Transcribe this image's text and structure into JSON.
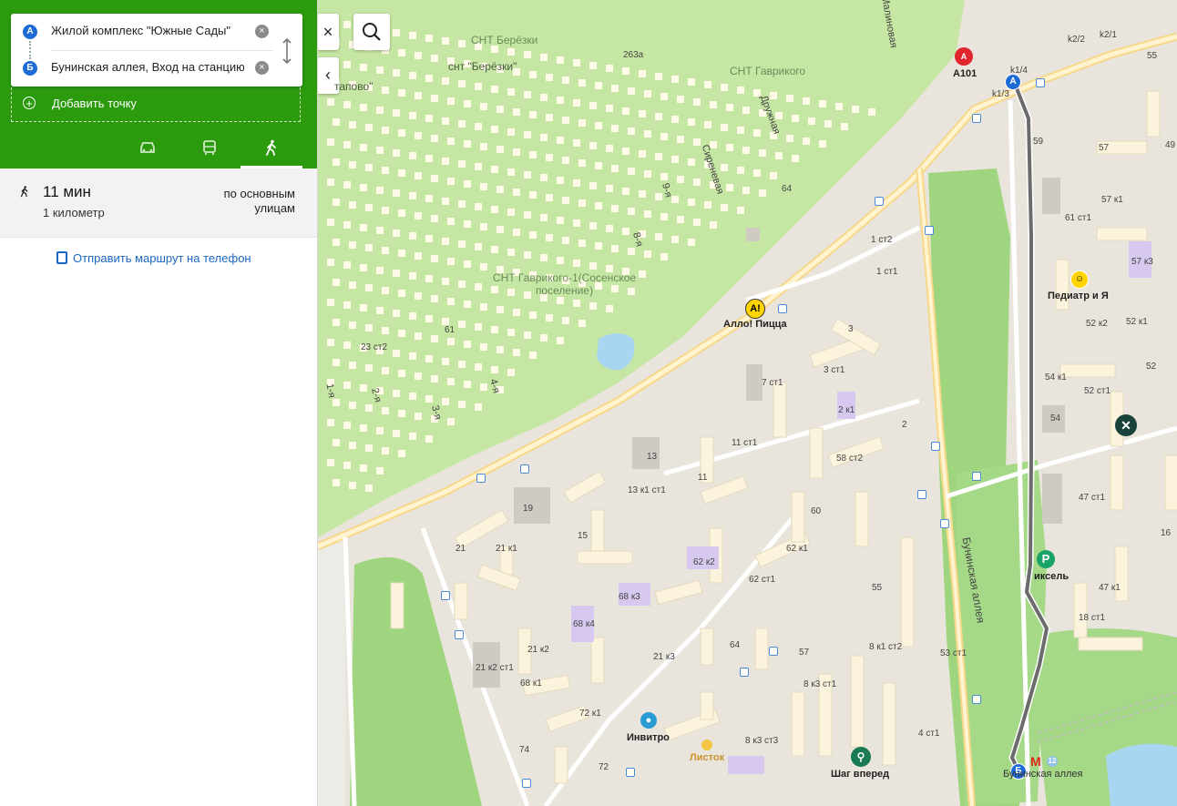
{
  "route_form": {
    "point_a": {
      "badge": "А",
      "text": "Жилой комплекс \"Южные Сады\""
    },
    "point_b": {
      "badge": "Б",
      "text": "Бунинская аллея, Вход на станцию"
    },
    "add_point": "Добавить точку",
    "active_mode": "walking",
    "modes": [
      "car",
      "transit",
      "walking"
    ]
  },
  "summary": {
    "duration": "11 мин",
    "distance": "1 километр",
    "via": "по основным улицам"
  },
  "send_to_phone": "Отправить маршрут на телефон",
  "map": {
    "controls": {
      "close": "×",
      "collapse": "‹"
    },
    "area_labels": {
      "snt_bereozki": "СНТ Берёзки",
      "snt_bereozki2": "снт \"Берёзки\"",
      "snt_gavrikovo": "СНТ Гаврикого",
      "snt_gavrikovo1": "СНТ Гаврикого-1(Сосенское поселение)",
      "stapovo": "тапово\""
    },
    "street_labels": {
      "druzhnaya": "Дружная",
      "sirenevaya": "Сиреневая",
      "malinovaya": "Малиновая",
      "buninskaya": "Бунинская аллея",
      "buninskaya_stop": "Бунинская аллея",
      "s9": "9-я",
      "s8": "8-я",
      "s4": "4-я",
      "s3": "3-я",
      "s2": "2-я",
      "s1": "1-я",
      "n263a": "263а",
      "n64": "64",
      "n61": "61",
      "n23st2": "23 ст2"
    },
    "pois": {
      "allo_pizza": "Алло! Пицца",
      "pediatr": "Педиатр и Я",
      "invitro": "Инвитро",
      "listok": "Листок",
      "shag_vpered": "Шаг вперед",
      "piksel": "иксель",
      "a101": "А101",
      "metro_line": "12"
    },
    "houses": [
      "k1/4",
      "k2/2",
      "k2/1",
      "k1/3",
      "55",
      "59",
      "57",
      "49",
      "57 к1",
      "61 ст1",
      "1 ст2",
      "1 ст1",
      "57 к3",
      "52 к2",
      "52 к1",
      "54 к1",
      "52",
      "52 ст1",
      "54",
      "3",
      "3 ст1",
      "2 к1",
      "2",
      "7 ст1",
      "11 ст1",
      "13",
      "13 к1 ст1",
      "11",
      "58 ст2",
      "19",
      "21",
      "21 к1",
      "15",
      "60",
      "62 к1",
      "62 к2",
      "62 ст1",
      "68 к3",
      "68 к4",
      "21 к2",
      "21 к3",
      "21 к2 ст1",
      "68 к1",
      "64",
      "57",
      "55",
      "8 к1 ст2",
      "53 ст1",
      "8 к3 ст1",
      "72 к1",
      "74",
      "72",
      "8 к3 ст3",
      "4 ст1",
      "47 ст1",
      "47 к1",
      "18 ст1",
      "16"
    ]
  },
  "colors": {
    "header_green": "#2b9a0d",
    "route": "#6b6b6b",
    "marker_blue": "#1e6bd6",
    "dacha_green": "#c6e7a3",
    "park_green": "#9fd57f"
  }
}
